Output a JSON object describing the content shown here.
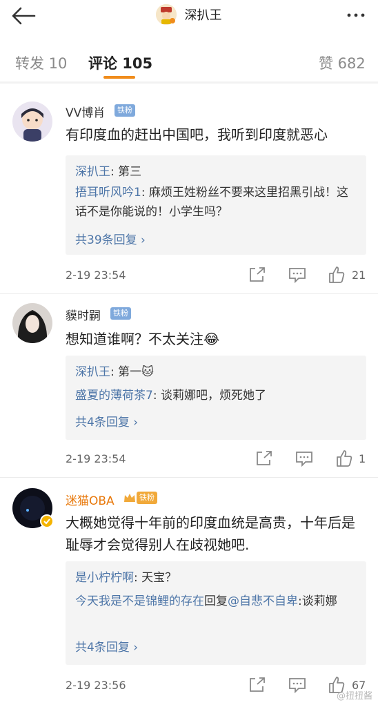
{
  "header": {
    "back_icon": "arrow-left-icon",
    "title": "深扒王",
    "more_icon": "ellipsis-icon"
  },
  "tabs": [
    {
      "label": "转发 10",
      "active": false
    },
    {
      "label": "评论 105",
      "active": true
    },
    {
      "label": "赞 682",
      "active": false
    }
  ],
  "comments": [
    {
      "user": "VV博肖",
      "badge": "铁粉",
      "text": "有印度血的赶出中国吧，我听到印度就恶心",
      "replies": [
        {
          "name": "深扒王",
          "text": ": 第三"
        },
        {
          "name": "捂耳听风吟1",
          "text": ": 麻烦王姓粉丝不要来这里招黑引战！这话不是你能说的！小学生吗？"
        }
      ],
      "more_replies": "共39条回复 ›",
      "time": "2-19 23:54",
      "likes": "21"
    },
    {
      "user": "貘时嗣",
      "badge": "铁粉",
      "text": "想知道谁啊？不太关注😂",
      "replies": [
        {
          "name": "深扒王",
          "text": ": 第一🐱"
        },
        {
          "name": "盛夏的薄荷茶7",
          "text": ": 谈莉娜吧，烦死她了"
        }
      ],
      "more_replies": "共4条回复 ›",
      "time": "2-19 23:54",
      "likes": "1"
    },
    {
      "user": "迷猫OBA",
      "badge": "铁粉",
      "text": "大概她觉得十年前的印度血统是高贵，十年后是耻辱才会觉得别人在歧视她吧.",
      "replies": [
        {
          "name": "是小柠柠啊",
          "text": ": 天宝？"
        },
        {
          "name": "今天我是不是锦鲤的存在",
          "text": "回复",
          "mention": "@自悲不自卑",
          "after": ":谈莉娜"
        }
      ],
      "more_replies": "共4条回复 ›",
      "time": "2-19 23:56",
      "likes": "67"
    }
  ],
  "watermark": "@扭扭酱",
  "colors": {
    "accent": "#f08c1c",
    "link": "#4e76a8",
    "orange_name": "#e8790c"
  }
}
